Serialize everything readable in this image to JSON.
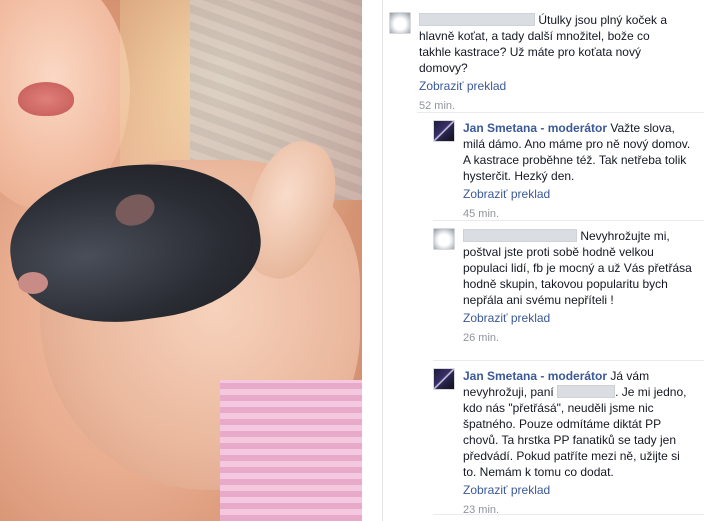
{
  "comments": [
    {
      "author": "",
      "text": "Útulky jsou plný koček a hlavně koťat, a tady další množitel, bože co takhle kastrace? Už máte pro koťata nový domovy?",
      "translate": "Zobraziť preklad",
      "time": "52 min."
    },
    {
      "author": "Jan Smetana - moderátor",
      "text": "Važte slova, milá dámo. Ano máme pro ně nový domov. A kastrace proběhne též. Tak netřeba tolik hysterčit. Hezký den.",
      "translate": "Zobraziť preklad",
      "time": "45 min."
    },
    {
      "author": "",
      "text": "Nevyhrožujte mi, poštval jste proti sobě hodně velkou populaci lidí, fb je mocný a už Vás přetřása hodně skupin, takovou popularitu bych nepřála ani svému nepříteli !",
      "translate": "Zobraziť preklad",
      "time": "26 min."
    },
    {
      "author": "Jan Smetana - moderátor",
      "text_a": "Já vám nevyhrožuji, paní",
      "text_b": ". Je mi jedno, kdo nás \"přetřásá\", neuděli jsme nic špatného. Pouze odmítáme diktát PP chovů. Ta hrstka PP fanatiků se tady jen předvádí. Pokud patříte mezi ně, užijte si to. Nemám k tomu co dodat.",
      "translate": "Zobraziť preklad",
      "time": "23 min."
    }
  ],
  "icons": {
    "avatar_user": "cat-avatar-icon",
    "avatar_moderator": "moderator-avatar-icon"
  },
  "colors": {
    "link": "#3b5998",
    "muted": "#90949c"
  }
}
